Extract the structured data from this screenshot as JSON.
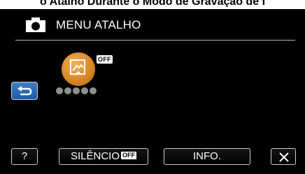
{
  "caption": "o Atalho Durante o Modo de Gravação de I",
  "header": {
    "icon": "camera-icon",
    "title": "MENU ATALHO"
  },
  "back_button": {
    "icon": "back-arrow-icon"
  },
  "mode": {
    "icon": "scene-mode-icon",
    "badge": "OFF"
  },
  "footer": {
    "help_label": "?",
    "silence_label": "SILÊNCIO",
    "silence_badge": "OFF",
    "info_label": "INFO.",
    "close_icon": "close-icon"
  },
  "colors": {
    "screen_bg": "#000000",
    "text": "#ffffff",
    "back_button": "#2e6bb7",
    "mode_icon": "#d68425"
  }
}
